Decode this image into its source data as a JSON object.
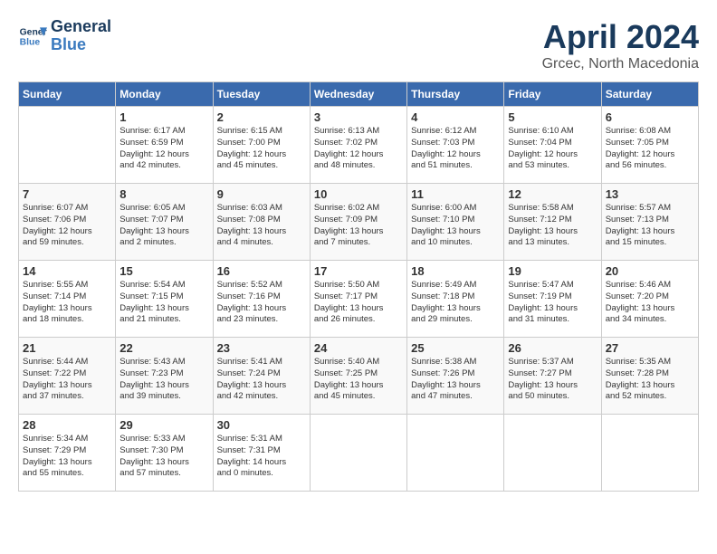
{
  "header": {
    "logo_line1": "General",
    "logo_line2": "Blue",
    "month_year": "April 2024",
    "location": "Grcec, North Macedonia"
  },
  "days_of_week": [
    "Sunday",
    "Monday",
    "Tuesday",
    "Wednesday",
    "Thursday",
    "Friday",
    "Saturday"
  ],
  "weeks": [
    [
      {
        "day": "",
        "info": ""
      },
      {
        "day": "1",
        "info": "Sunrise: 6:17 AM\nSunset: 6:59 PM\nDaylight: 12 hours\nand 42 minutes."
      },
      {
        "day": "2",
        "info": "Sunrise: 6:15 AM\nSunset: 7:00 PM\nDaylight: 12 hours\nand 45 minutes."
      },
      {
        "day": "3",
        "info": "Sunrise: 6:13 AM\nSunset: 7:02 PM\nDaylight: 12 hours\nand 48 minutes."
      },
      {
        "day": "4",
        "info": "Sunrise: 6:12 AM\nSunset: 7:03 PM\nDaylight: 12 hours\nand 51 minutes."
      },
      {
        "day": "5",
        "info": "Sunrise: 6:10 AM\nSunset: 7:04 PM\nDaylight: 12 hours\nand 53 minutes."
      },
      {
        "day": "6",
        "info": "Sunrise: 6:08 AM\nSunset: 7:05 PM\nDaylight: 12 hours\nand 56 minutes."
      }
    ],
    [
      {
        "day": "7",
        "info": "Sunrise: 6:07 AM\nSunset: 7:06 PM\nDaylight: 12 hours\nand 59 minutes."
      },
      {
        "day": "8",
        "info": "Sunrise: 6:05 AM\nSunset: 7:07 PM\nDaylight: 13 hours\nand 2 minutes."
      },
      {
        "day": "9",
        "info": "Sunrise: 6:03 AM\nSunset: 7:08 PM\nDaylight: 13 hours\nand 4 minutes."
      },
      {
        "day": "10",
        "info": "Sunrise: 6:02 AM\nSunset: 7:09 PM\nDaylight: 13 hours\nand 7 minutes."
      },
      {
        "day": "11",
        "info": "Sunrise: 6:00 AM\nSunset: 7:10 PM\nDaylight: 13 hours\nand 10 minutes."
      },
      {
        "day": "12",
        "info": "Sunrise: 5:58 AM\nSunset: 7:12 PM\nDaylight: 13 hours\nand 13 minutes."
      },
      {
        "day": "13",
        "info": "Sunrise: 5:57 AM\nSunset: 7:13 PM\nDaylight: 13 hours\nand 15 minutes."
      }
    ],
    [
      {
        "day": "14",
        "info": "Sunrise: 5:55 AM\nSunset: 7:14 PM\nDaylight: 13 hours\nand 18 minutes."
      },
      {
        "day": "15",
        "info": "Sunrise: 5:54 AM\nSunset: 7:15 PM\nDaylight: 13 hours\nand 21 minutes."
      },
      {
        "day": "16",
        "info": "Sunrise: 5:52 AM\nSunset: 7:16 PM\nDaylight: 13 hours\nand 23 minutes."
      },
      {
        "day": "17",
        "info": "Sunrise: 5:50 AM\nSunset: 7:17 PM\nDaylight: 13 hours\nand 26 minutes."
      },
      {
        "day": "18",
        "info": "Sunrise: 5:49 AM\nSunset: 7:18 PM\nDaylight: 13 hours\nand 29 minutes."
      },
      {
        "day": "19",
        "info": "Sunrise: 5:47 AM\nSunset: 7:19 PM\nDaylight: 13 hours\nand 31 minutes."
      },
      {
        "day": "20",
        "info": "Sunrise: 5:46 AM\nSunset: 7:20 PM\nDaylight: 13 hours\nand 34 minutes."
      }
    ],
    [
      {
        "day": "21",
        "info": "Sunrise: 5:44 AM\nSunset: 7:22 PM\nDaylight: 13 hours\nand 37 minutes."
      },
      {
        "day": "22",
        "info": "Sunrise: 5:43 AM\nSunset: 7:23 PM\nDaylight: 13 hours\nand 39 minutes."
      },
      {
        "day": "23",
        "info": "Sunrise: 5:41 AM\nSunset: 7:24 PM\nDaylight: 13 hours\nand 42 minutes."
      },
      {
        "day": "24",
        "info": "Sunrise: 5:40 AM\nSunset: 7:25 PM\nDaylight: 13 hours\nand 45 minutes."
      },
      {
        "day": "25",
        "info": "Sunrise: 5:38 AM\nSunset: 7:26 PM\nDaylight: 13 hours\nand 47 minutes."
      },
      {
        "day": "26",
        "info": "Sunrise: 5:37 AM\nSunset: 7:27 PM\nDaylight: 13 hours\nand 50 minutes."
      },
      {
        "day": "27",
        "info": "Sunrise: 5:35 AM\nSunset: 7:28 PM\nDaylight: 13 hours\nand 52 minutes."
      }
    ],
    [
      {
        "day": "28",
        "info": "Sunrise: 5:34 AM\nSunset: 7:29 PM\nDaylight: 13 hours\nand 55 minutes."
      },
      {
        "day": "29",
        "info": "Sunrise: 5:33 AM\nSunset: 7:30 PM\nDaylight: 13 hours\nand 57 minutes."
      },
      {
        "day": "30",
        "info": "Sunrise: 5:31 AM\nSunset: 7:31 PM\nDaylight: 14 hours\nand 0 minutes."
      },
      {
        "day": "",
        "info": ""
      },
      {
        "day": "",
        "info": ""
      },
      {
        "day": "",
        "info": ""
      },
      {
        "day": "",
        "info": ""
      }
    ]
  ]
}
